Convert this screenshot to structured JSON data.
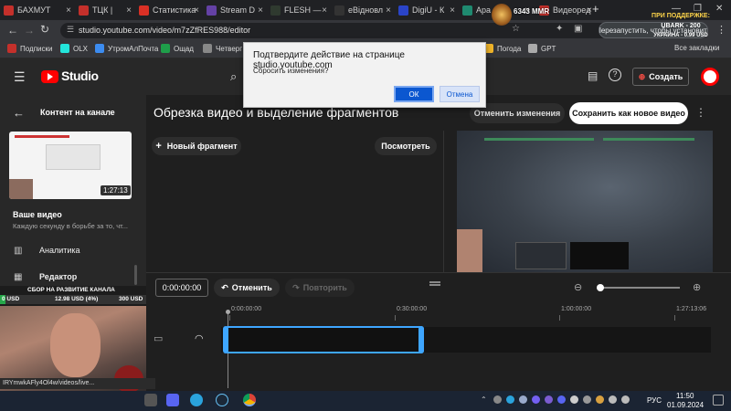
{
  "browser": {
    "tabs": [
      {
        "label": "БАХМУТ",
        "color": "#c4302b"
      },
      {
        "label": "ТЦК |",
        "color": "#c4302b"
      },
      {
        "label": "Статистика",
        "color": "#d93025"
      },
      {
        "label": "Stream D",
        "color": "#6441a5"
      },
      {
        "label": "FLESH —",
        "color": "#2f3a2f"
      },
      {
        "label": "eВідновл",
        "color": "#333333"
      },
      {
        "label": "DigiU - К",
        "color": "#2a44c8"
      },
      {
        "label": "Apa",
        "color": "#1f8a70"
      },
      {
        "label": "Видеоред",
        "color": "#c4302b"
      }
    ],
    "url": "studio.youtube.com/video/m7zZfRES988/editor",
    "restart_button": "Перезапустить, чтобы установить",
    "bookmarks": [
      "Подписки",
      "OLX",
      "УтромАлПочта",
      "Ощад",
      "Четверг"
    ],
    "bookmarks_right": [
      "Погода",
      "GPT"
    ],
    "all_bookmarks": "Все закладки"
  },
  "studio": {
    "logo": "Studio",
    "search_icon": "search-icon",
    "create_label": "Создать",
    "sidebar": {
      "back_label": "Контент на канале",
      "video_duration": "1:27:13",
      "video_title": "Ваше видео",
      "video_sub": "Каждую секунду в борьбе за то, чт...",
      "items": [
        {
          "label": "Аналитика",
          "icon": "bar-chart-icon"
        },
        {
          "label": "Редактор",
          "icon": "film-icon"
        }
      ]
    },
    "editor": {
      "title": "Обрезка видео и выделение фрагментов",
      "cancel_changes": "Отменить изменения",
      "save_new": "Сохранить как новое видео",
      "new_fragment": "Новый фрагмент",
      "preview": "Посмотреть"
    },
    "timeline": {
      "current_time": "0:00:00:00",
      "undo": "Отменить",
      "redo": "Повторить",
      "ticks": [
        "0:00:00:00",
        "0:30:00:00",
        "1:00:00:00",
        "1:27:13:06"
      ]
    }
  },
  "dialog": {
    "title": "Подтвердите действие на странице studio.youtube.com",
    "message": "Сбросить изменения?",
    "ok": "ОК",
    "cancel": "Отмена"
  },
  "overlay": {
    "counter": "6343 MMR",
    "support_title": "ПРИ ПОДДЕРЖКЕ:",
    "support_line1": "UBARK - 200",
    "support_line2": "УКРАИНА - 0.99 USD",
    "donation_title": "СБОР НА РАЗВИТИЕ КАНАЛА",
    "donation_min": "0 USD",
    "donation_current": "12.98 USD (4%)",
    "donation_max": "300 USD",
    "donation_progress": 0.04,
    "link_text": "IRYmwkAFly4Ol4w/videos/live..."
  },
  "taskbar": {
    "lang": "РУС",
    "time": "11:50",
    "date": "01.09.2024"
  }
}
